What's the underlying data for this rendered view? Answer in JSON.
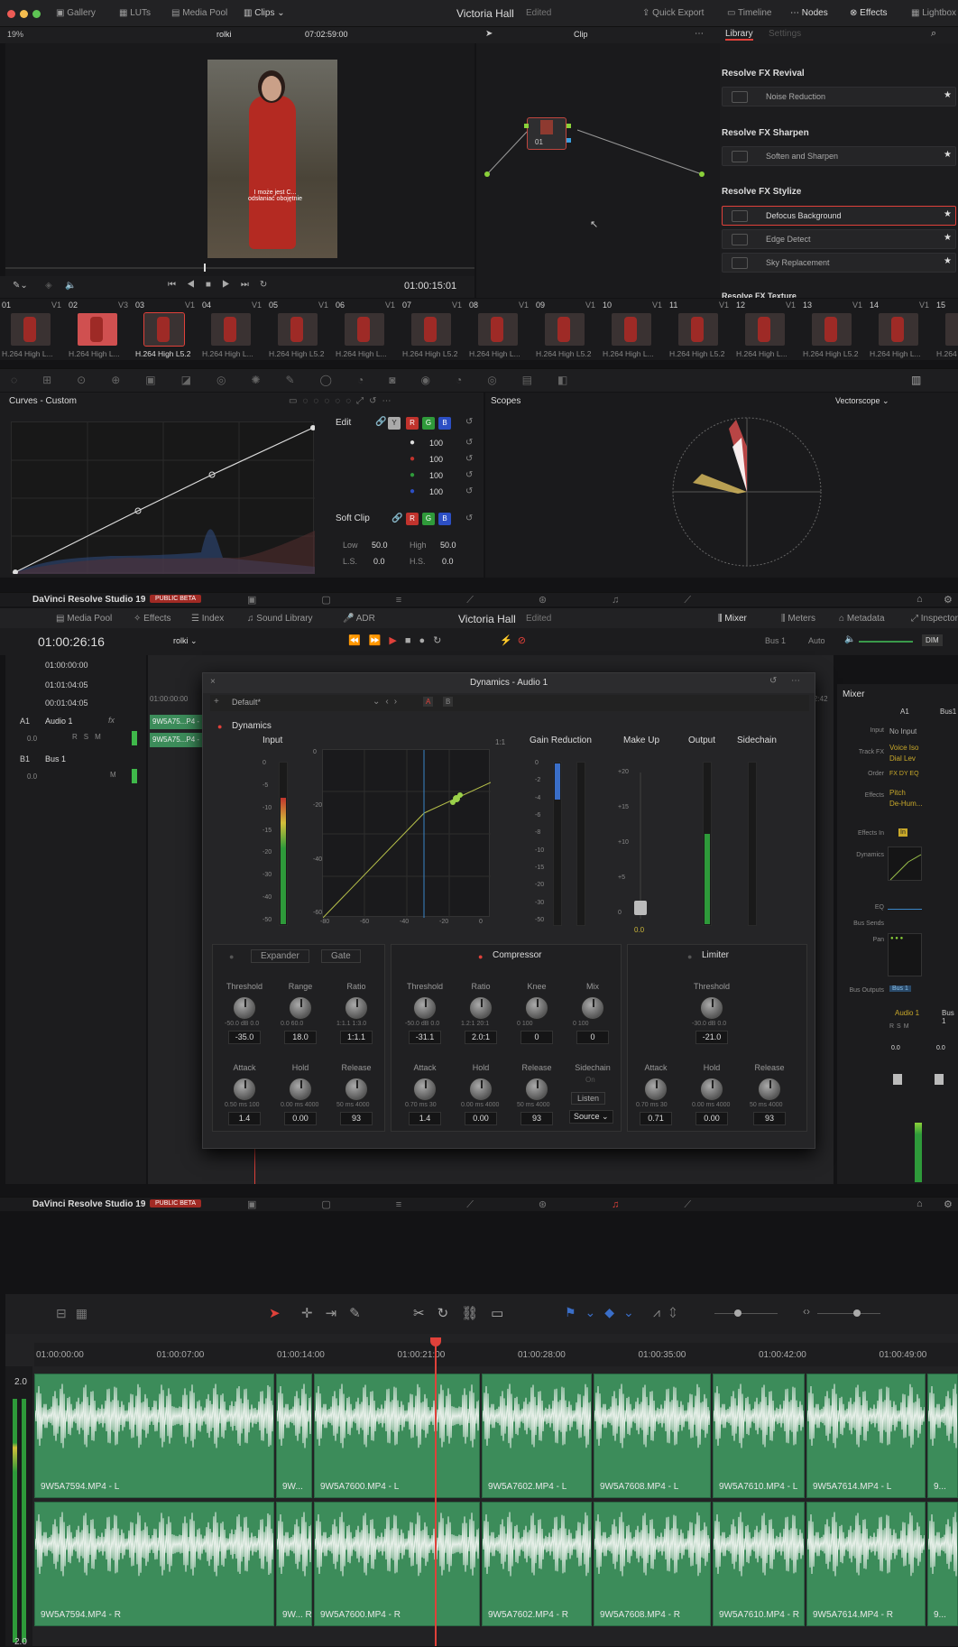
{
  "topbar": {
    "gallery": "Gallery",
    "luts": "LUTs",
    "media_pool": "Media Pool",
    "clips": "Clips",
    "title": "Victoria Hall",
    "edited": "Edited",
    "quick_export": "Quick Export",
    "timeline": "Timeline",
    "nodes": "Nodes",
    "effects": "Effects",
    "lightbox": "Lightbox"
  },
  "viewer": {
    "zoom": "19%",
    "clip_name": "rolki",
    "timecode_top": "07:02:59:00",
    "clip_mode": "Clip",
    "timecode": "01:00:15:01",
    "subtitle": "I może jest C...\nodsłaniać obojętnie"
  },
  "library": {
    "tab_library": "Library",
    "tab_settings": "Settings",
    "groups": [
      {
        "title": "Resolve FX Revival",
        "items": [
          "Noise Reduction"
        ]
      },
      {
        "title": "Resolve FX Sharpen",
        "items": [
          "Soften and Sharpen"
        ]
      },
      {
        "title": "Resolve FX Stylize",
        "items": [
          "Defocus Background",
          "Edge Detect",
          "Sky Replacement"
        ]
      }
    ],
    "partial": "Resolve FX Texture"
  },
  "node": {
    "label": "01"
  },
  "clips": [
    {
      "n": "01",
      "t": "V1",
      "c": "H.264 High L..."
    },
    {
      "n": "02",
      "t": "V3",
      "c": "H.264 High L..."
    },
    {
      "n": "03",
      "t": "V1",
      "c": "H.264 High L5.2"
    },
    {
      "n": "04",
      "t": "V1",
      "c": "H.264 High L..."
    },
    {
      "n": "05",
      "t": "V1",
      "c": "H.264 High L5.2"
    },
    {
      "n": "06",
      "t": "V1",
      "c": "H.264 High L..."
    },
    {
      "n": "07",
      "t": "V1",
      "c": "H.264 High L5.2"
    },
    {
      "n": "08",
      "t": "V1",
      "c": "H.264 High L..."
    },
    {
      "n": "09",
      "t": "V1",
      "c": "H.264 High L5.2"
    },
    {
      "n": "10",
      "t": "V1",
      "c": "H.264 High L..."
    },
    {
      "n": "11",
      "t": "V1",
      "c": "H.264 High L5.2"
    },
    {
      "n": "12",
      "t": "V1",
      "c": "H.264 High L..."
    },
    {
      "n": "13",
      "t": "V1",
      "c": "H.264 High L5.2"
    },
    {
      "n": "14",
      "t": "V1",
      "c": "H.264 High L..."
    },
    {
      "n": "15",
      "t": "V1",
      "c": "H.264 H"
    }
  ],
  "curves": {
    "title": "Curves - Custom",
    "edit": "Edit",
    "y": "Y",
    "r": "R",
    "g": "G",
    "b": "B",
    "values": [
      "100",
      "100",
      "100",
      "100"
    ],
    "soft_clip": "Soft Clip",
    "low_label": "Low",
    "low": "50.0",
    "high_label": "High",
    "high": "50.0",
    "ls_label": "L.S.",
    "ls": "0.0",
    "hs_label": "H.S.",
    "hs": "0.0"
  },
  "scopes": {
    "title": "Scopes",
    "mode": "Vectorscope"
  },
  "bottom_bar": {
    "app": "DaVinci Resolve Studio 19",
    "beta": "PUBLIC BETA"
  },
  "fairlight": {
    "media_pool": "Media Pool",
    "effects": "Effects",
    "index": "Index",
    "sound_library": "Sound Library",
    "adr": "ADR",
    "title": "Victoria Hall",
    "edited": "Edited",
    "mixer": "Mixer",
    "meters": "Meters",
    "metadata": "Metadata",
    "inspector": "Inspector",
    "timecode": "01:00:26:16",
    "clip": "rolki",
    "bus": "Bus 1",
    "auto": "Auto",
    "dim": "DIM",
    "tc1": "01:00:00:00",
    "tc2": "01:01:04:05",
    "tc3": "00:01:04:05",
    "a1": "A1",
    "audio1": "Audio 1",
    "fx": "fx",
    "vol": "0.0",
    "b1": "B1",
    "bus1": "Bus 1",
    "bvol": "0.0",
    "clipA": "9W5A75...P4 -",
    "clipB": "9W5A75...P4 -",
    "ruler0": "01:00:00:00",
    "ruler_end": "2:42"
  },
  "dynamics": {
    "title": "Dynamics - Audio 1",
    "preset": "Default*",
    "a": "A",
    "b": "B",
    "dynamics": "Dynamics",
    "input": "Input",
    "ratio_label": "1:1",
    "gain_reduction": "Gain Reduction",
    "make_up": "Make Up",
    "output": "Output",
    "sidechain": "Sidechain",
    "makeup_value": "0.0",
    "input_scale": [
      "0",
      "-5",
      "-10",
      "-15",
      "-20",
      "-30",
      "-40",
      "-50"
    ],
    "graph_x": [
      "-80",
      "-60",
      "-40",
      "-20",
      "0"
    ],
    "graph_y": [
      "0",
      "-20",
      "-40",
      "-60"
    ],
    "gr_scale": [
      "0",
      "-2",
      "-4",
      "-6",
      "-8",
      "-10",
      "-15",
      "-20",
      "-30",
      "-50"
    ],
    "makeup_scale": [
      "+20",
      "+15",
      "+10",
      "+5",
      "0"
    ],
    "expander": "Expander",
    "gate": "Gate",
    "compressor": "Compressor",
    "limiter": "Limiter",
    "exp": {
      "threshold": "Threshold",
      "threshold_v": "-35.0",
      "threshold_r": "-50.0 dB  0.0",
      "range": "Range",
      "range_v": "18.0",
      "range_r": "0.0   60.0",
      "ratio": "Ratio",
      "ratio_v": "1:1.1",
      "ratio_r": "1:1.1  1:3.0",
      "attack": "Attack",
      "attack_v": "1.4",
      "attack_r": "0.50  ms  100",
      "hold": "Hold",
      "hold_v": "0.00",
      "hold_r": "0.00  ms  4000",
      "release": "Release",
      "release_v": "93",
      "release_r": "50  ms  4000"
    },
    "comp": {
      "threshold": "Threshold",
      "threshold_v": "-31.1",
      "threshold_r": "-50.0 dB  0.0",
      "ratio": "Ratio",
      "ratio_v": "2.0:1",
      "ratio_r": "1.2:1  20:1",
      "knee": "Knee",
      "knee_v": "0",
      "knee_r": "0   100",
      "mix": "Mix",
      "mix_v": "0",
      "mix_r": "0   100",
      "attack": "Attack",
      "attack_v": "1.4",
      "attack_r": "0.70  ms  30",
      "hold": "Hold",
      "hold_v": "0.00",
      "hold_r": "0.00  ms  4000",
      "release": "Release",
      "release_v": "93",
      "release_r": "50  ms  4000",
      "sidechain": "Sidechain",
      "on": "On",
      "listen": "Listen",
      "source": "Source"
    },
    "lim": {
      "threshold": "Threshold",
      "threshold_v": "-21.0",
      "threshold_r": "-30.0 dB  0.0",
      "attack": "Attack",
      "attack_v": "0.71",
      "attack_r": "0.70  ms  30",
      "hold": "Hold",
      "hold_v": "0.00",
      "hold_r": "0.00  ms  4000",
      "release": "Release",
      "release_v": "93",
      "release_r": "50  ms  4000"
    }
  },
  "mixer": {
    "title": "Mixer",
    "a1": "A1",
    "bus1": "Bus1",
    "input": "Input",
    "no_input": "No Input",
    "track_fx": "Track FX",
    "fx1": "Voice Iso",
    "fx2": "Dial Lev",
    "order": "Order",
    "order_v": "FX DY EQ",
    "effects": "Effects",
    "eff1": "Pitch",
    "eff2": "De-Hum...",
    "effects_in": "Effects In",
    "in": "In",
    "dynamics": "Dynamics",
    "eq": "EQ",
    "bus_sends": "Bus Sends",
    "pan": "Pan",
    "bus_outputs": "Bus Outputs",
    "bus_out": "Bus 1",
    "ch1": "Audio 1",
    "ch2": "Bus 1",
    "v1": "0.0",
    "v2": "0.0"
  },
  "timeline": {
    "ruler": [
      "01:00:00:00",
      "01:00:07:00",
      "01:00:14:00",
      "01:00:21:00",
      "01:00:28:00",
      "01:00:35:00",
      "01:00:42:00",
      "01:00:49:00"
    ],
    "level_top": "2.0",
    "level_bottom": "2.0",
    "clipsL": [
      "9W5A7594.MP4 - L",
      "9W...",
      "9W5A7600.MP4 - L",
      "9W5A7602.MP4 - L",
      "9W5A7608.MP4 - L",
      "9W5A7610.MP4 - L",
      "9W5A7614.MP4 - L",
      "9..."
    ],
    "clipsR": [
      "9W5A7594.MP4 - R",
      "9W... R",
      "9W5A7600.MP4 - R",
      "9W5A7602.MP4 - R",
      "9W5A7608.MP4 - R",
      "9W5A7610.MP4 - R",
      "9W5A7614.MP4 - R",
      "9..."
    ]
  },
  "colors": {
    "accent": "#e0413a",
    "green_clip": "#3c8c5a",
    "panel": "#1c1c1e"
  }
}
